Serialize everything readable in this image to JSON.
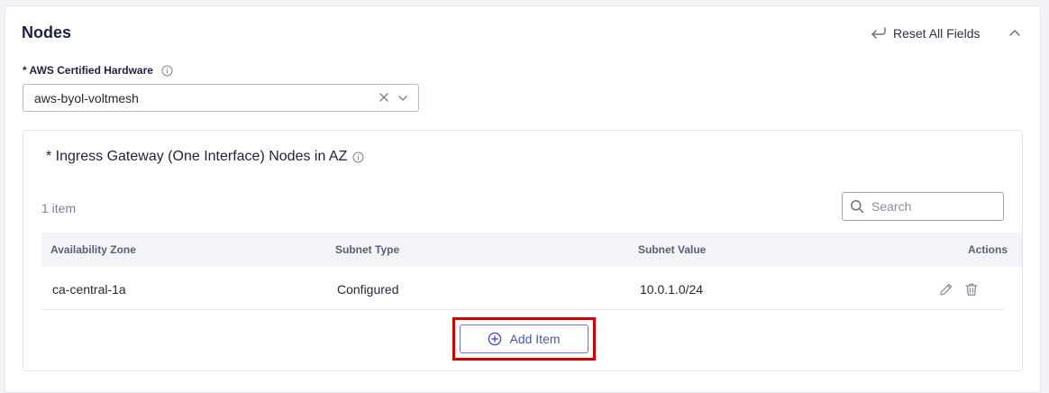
{
  "section": {
    "title": "Nodes",
    "reset_label": "Reset All Fields"
  },
  "hardware_field": {
    "label": "* AWS Certified Hardware",
    "value": "aws-byol-voltmesh"
  },
  "nodes_block": {
    "title": "* Ingress Gateway (One Interface) Nodes in AZ",
    "count_text": "1 item",
    "search_placeholder": "Search",
    "columns": [
      "Availability Zone",
      "Subnet Type",
      "Subnet Value",
      "Actions"
    ],
    "rows": [
      {
        "zone": "ca-central-1a",
        "subnet_type": "Configured",
        "subnet_value": "10.0.1.0/24"
      }
    ],
    "add_item_label": "Add Item"
  },
  "colors": {
    "accent": "#4a55b8",
    "highlight_box": "#d20000",
    "header_bg": "#f3f4f7"
  },
  "icons": [
    "reset-icon",
    "chevron-up-icon",
    "info-icon",
    "clear-icon",
    "chevron-down-icon",
    "search-icon",
    "edit-icon",
    "trash-icon",
    "plus-circle-icon"
  ]
}
